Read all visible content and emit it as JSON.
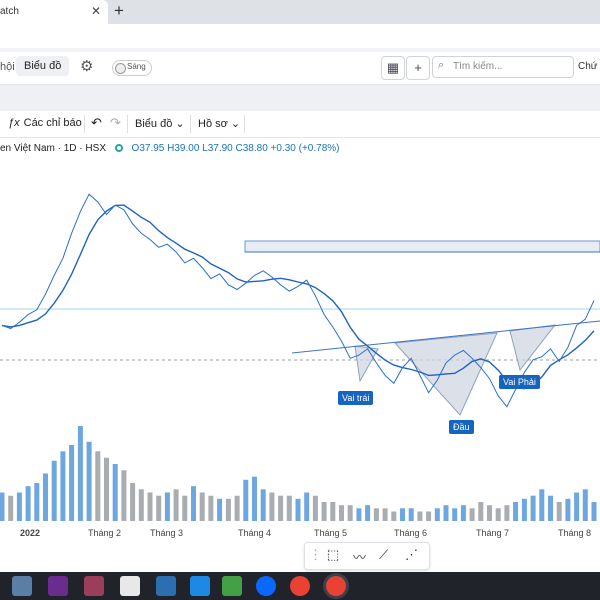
{
  "browser": {
    "tab_title": "atch",
    "tab_close": "✕",
    "new_tab": "+"
  },
  "app_toolbar": {
    "nav_partial": "hội",
    "nav_chart": "Biểu đồ",
    "gear_icon": "gear-icon",
    "theme_toggle_label": "Sáng",
    "search_placeholder": "Tìm kiếm...",
    "stock_partial": "Chứ"
  },
  "chart_toolbar": {
    "indicators": "Các chỉ báo",
    "chart": "Biểu đồ",
    "profile": "Hồ sơ"
  },
  "symbol": {
    "name": "en Việt Nam",
    "interval": "1D",
    "exchange": "HSX",
    "ohlc": "O37.95 H39.00 L37.90 C38.80 +0.30 (+0.78%)"
  },
  "annotations": {
    "left_shoulder": "Vai trái",
    "head": "Đầu",
    "right_shoulder": "Vai Phải"
  },
  "x_axis": {
    "labels": [
      "2022",
      "Tháng 2",
      "Tháng 3",
      "Tháng 4",
      "Tháng 5",
      "Tháng 6",
      "Tháng 7",
      "Tháng 8"
    ]
  },
  "colors": {
    "price_line": "#1e62c6",
    "volume_up": "#6ea6e0",
    "volume_down": "#a9acb1",
    "pattern_fill": "#cfd6e2",
    "accent": "#1565c0"
  },
  "chart_data": {
    "type": "line",
    "x_unit": "trading session index (1 = first visible session)",
    "y_unit": "price (thousand VND)",
    "series": [],
    "y_values": [
      30.5,
      30.3,
      30.7,
      31.2,
      31.5,
      32.5,
      33.7,
      34.8,
      36.4,
      37.8,
      38.9,
      38.4,
      37.6,
      38.2,
      37.9,
      37.0,
      36.4,
      36.0,
      35.5,
      35.7,
      35.2,
      34.5,
      34.8,
      34.2,
      33.5,
      33.8,
      33.1,
      32.8,
      33.2,
      33.7,
      34.0,
      33.6,
      33.1,
      32.7,
      33.0,
      33.4,
      32.4,
      31.2,
      30.4,
      29.5,
      28.4,
      28.6,
      29.0,
      28.1,
      27.3,
      26.8,
      27.8,
      28.4,
      27.3,
      26.2,
      27.0,
      28.1,
      28.6,
      28.9,
      28.4,
      27.8,
      27.1,
      26.0,
      25.3,
      26.4,
      27.5,
      28.3,
      28.5,
      29.0,
      28.2,
      29.1,
      30.5,
      30.9,
      32.1
    ],
    "volume": [
      0.9,
      0.8,
      0.9,
      1.1,
      1.2,
      1.5,
      1.9,
      2.2,
      2.4,
      3.0,
      2.5,
      2.2,
      2.0,
      1.8,
      1.6,
      1.2,
      1.0,
      0.9,
      0.8,
      0.9,
      1.0,
      0.8,
      1.1,
      0.9,
      0.8,
      0.7,
      0.7,
      0.8,
      1.3,
      1.4,
      1.0,
      0.9,
      0.8,
      0.8,
      0.7,
      0.9,
      0.8,
      0.6,
      0.6,
      0.5,
      0.5,
      0.4,
      0.5,
      0.4,
      0.4,
      0.3,
      0.4,
      0.4,
      0.3,
      0.3,
      0.4,
      0.5,
      0.4,
      0.5,
      0.4,
      0.6,
      0.5,
      0.4,
      0.5,
      0.6,
      0.7,
      0.8,
      1.0,
      0.8,
      0.6,
      0.7,
      0.9,
      1.0,
      0.6
    ]
  }
}
